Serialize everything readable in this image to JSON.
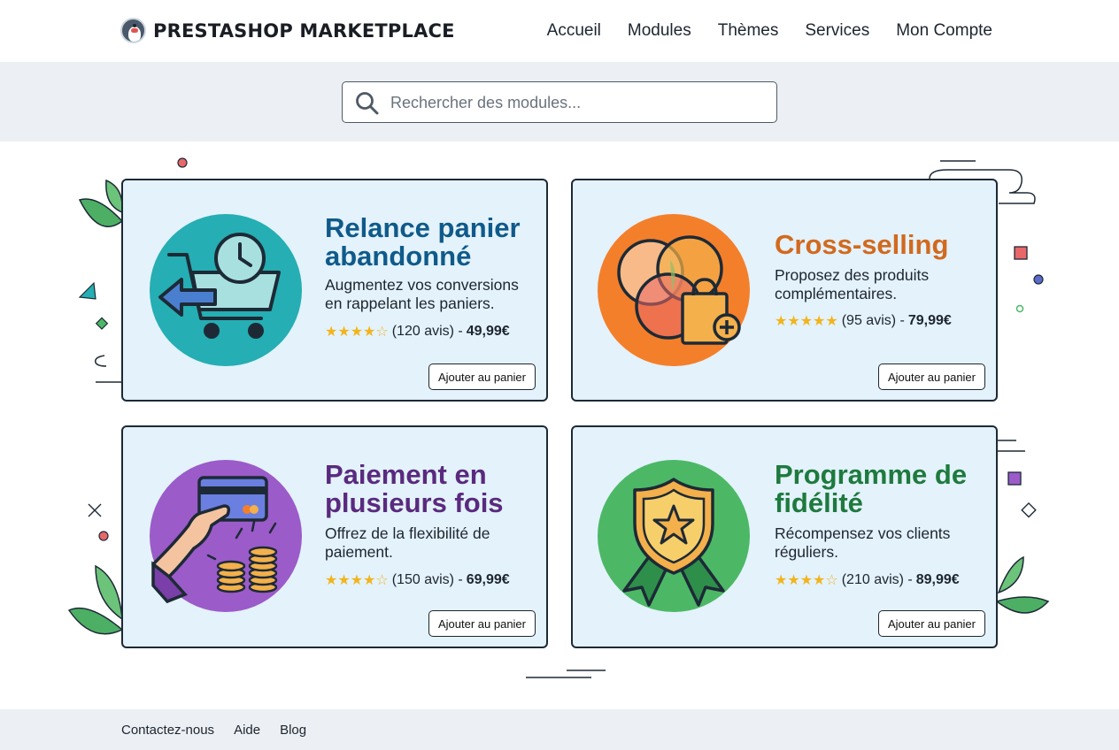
{
  "header": {
    "logo_text": "PRESTASHOP MARKETPLACE",
    "nav": [
      "Accueil",
      "Modules",
      "Thèmes",
      "Services",
      "Mon Compte"
    ]
  },
  "search": {
    "placeholder": "Rechercher des modules..."
  },
  "cards": [
    {
      "title_line1": "Relance panier",
      "title_line2": "abandonné",
      "desc_line1": "Augmentez vos conversions",
      "desc_line2": "en rappelant les paniers.",
      "stars": "★★★★☆",
      "reviews": "(120 avis) -",
      "price": "49,99€",
      "button": "Ajouter au panier",
      "title_color": "#0f5a8a",
      "circle_color": "#25aeb3"
    },
    {
      "title_line1": "Cross-selling",
      "desc_line1": "Proposez des produits",
      "desc_line2": "complémentaires.",
      "stars": "★★★★★",
      "reviews": "(95 avis) -",
      "price": "79,99€",
      "button": "Ajouter au panier",
      "title_color": "#d2691e",
      "circle_color": "#f47f2a"
    },
    {
      "title_line1": "Paiement en",
      "title_line2": "plusieurs fois",
      "desc_line1": "Offrez de la flexibilité de",
      "desc_line2": "paiement.",
      "stars": "★★★★☆",
      "reviews": "(150 avis) -",
      "price": "69,99€",
      "button": "Ajouter au panier",
      "title_color": "#5a2a7e",
      "circle_color": "#9b5bc9"
    },
    {
      "title_line1": "Programme de",
      "title_line2": "fidélité",
      "desc_line1": "Récompensez vos clients",
      "desc_line2": "réguliers.",
      "stars": "★★★★☆",
      "reviews": "(210 avis) -",
      "price": "89,99€",
      "button": "Ajouter au panier",
      "title_color": "#1e7a3e",
      "circle_color": "#4cb866"
    }
  ],
  "footer": {
    "links": [
      "Contactez-nous",
      "Aide",
      "Blog"
    ]
  }
}
